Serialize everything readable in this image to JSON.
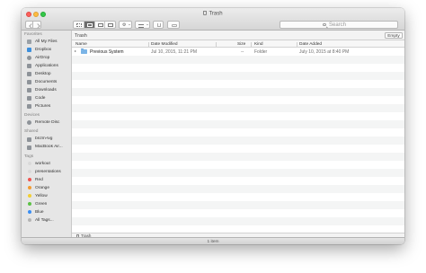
{
  "window": {
    "title": "Trash"
  },
  "toolbar": {
    "search_placeholder": "Search",
    "action_glyph": "⚙"
  },
  "sidebar": {
    "sections": [
      {
        "title": "Favorites",
        "items": [
          {
            "label": "All My Files",
            "icon": "all-files-icon",
            "color": "#9aa0a6"
          },
          {
            "label": "Dropbox",
            "icon": "dropbox-icon",
            "color": "#3d8fdc"
          },
          {
            "label": "AirDrop",
            "icon": "airdrop-icon",
            "color": "#8e9399"
          },
          {
            "label": "Applications",
            "icon": "applications-icon",
            "color": "#8e9399"
          },
          {
            "label": "Desktop",
            "icon": "desktop-icon",
            "color": "#8e9399"
          },
          {
            "label": "Documents",
            "icon": "documents-icon",
            "color": "#8e9399"
          },
          {
            "label": "Downloads",
            "icon": "downloads-icon",
            "color": "#8e9399"
          },
          {
            "label": "Code",
            "icon": "folder-icon",
            "color": "#8e9399"
          },
          {
            "label": "Pictures",
            "icon": "pictures-icon",
            "color": "#8e9399"
          }
        ]
      },
      {
        "title": "Devices",
        "items": [
          {
            "label": "Remote Disc",
            "icon": "remote-disc-icon",
            "color": "#8e9399"
          }
        ]
      },
      {
        "title": "Shared",
        "items": [
          {
            "label": "bnzm-lvg",
            "icon": "shared-computer-icon",
            "color": "#8e9399"
          },
          {
            "label": "MacBook Air...",
            "icon": "laptop-icon",
            "color": "#8e9399"
          }
        ]
      },
      {
        "title": "Tags",
        "items": [
          {
            "label": "workout",
            "icon": "tag-icon",
            "color": "#d9d9d9"
          },
          {
            "label": "presentations",
            "icon": "tag-icon",
            "color": "#d9d9d9"
          },
          {
            "label": "Red",
            "icon": "tag-icon",
            "color": "#f0544f"
          },
          {
            "label": "Orange",
            "icon": "tag-icon",
            "color": "#f39c31"
          },
          {
            "label": "Yellow",
            "icon": "tag-icon",
            "color": "#f2cf33"
          },
          {
            "label": "Green",
            "icon": "tag-icon",
            "color": "#5cc146"
          },
          {
            "label": "Blue",
            "icon": "tag-icon",
            "color": "#3a8ef3"
          },
          {
            "label": "All Tags...",
            "icon": "all-tags-icon",
            "color": "#b5b5b5"
          }
        ]
      }
    ]
  },
  "content": {
    "location_label": "Trash",
    "empty_button": "Empty",
    "columns": {
      "name": "Name",
      "date_modified": "Date Modified",
      "size": "Size",
      "kind": "Kind",
      "date_added": "Date Added"
    },
    "rows": [
      {
        "name": "Previous System",
        "date_modified": "Jul 10, 2015, 11:21 PM",
        "size": "--",
        "kind": "Folder",
        "date_added": "July 10, 2015 at 8:40 PM"
      }
    ],
    "path_bar": "Trash"
  },
  "status": {
    "text": "1 item"
  }
}
